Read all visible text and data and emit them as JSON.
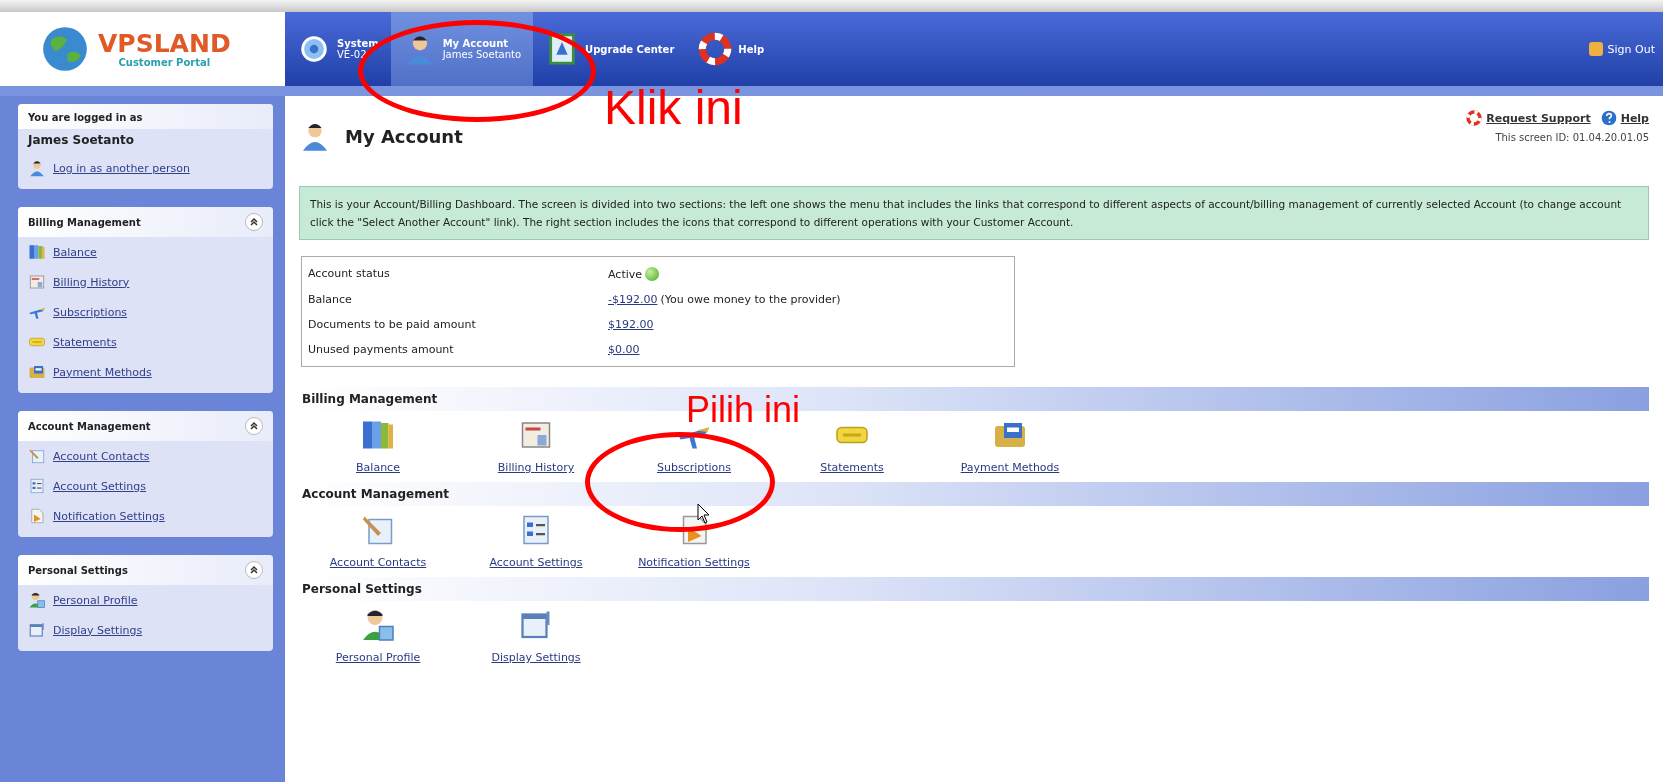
{
  "header": {
    "logo": {
      "name": "VPSLAND",
      "subtitle": "Customer Portal"
    },
    "tabs": [
      {
        "kind": "system",
        "title": "System",
        "subtitle": "VE-02",
        "selected": false
      },
      {
        "kind": "account",
        "title": "My Account",
        "subtitle": "James Soetanto",
        "selected": true
      },
      {
        "kind": "upgrade",
        "title": "Upgrade Center",
        "selected": false
      },
      {
        "kind": "help",
        "title": "Help",
        "selected": false
      }
    ],
    "sign_out": "Sign Out"
  },
  "sidebar": {
    "login": {
      "label": "You are logged in as",
      "user": "James Soetanto",
      "link": "Log in as another person"
    },
    "panels": [
      {
        "title": "Billing Management",
        "expanded": true,
        "items": [
          {
            "kind": "balance",
            "label": "Balance"
          },
          {
            "kind": "history",
            "label": "Billing History"
          },
          {
            "kind": "subscriptions",
            "label": "Subscriptions"
          },
          {
            "kind": "statements",
            "label": "Statements"
          },
          {
            "kind": "payment",
            "label": "Payment Methods"
          }
        ]
      },
      {
        "title": "Account Management",
        "expanded": true,
        "items": [
          {
            "kind": "contacts",
            "label": "Account Contacts"
          },
          {
            "kind": "settings",
            "label": "Account Settings"
          },
          {
            "kind": "notification",
            "label": "Notification Settings"
          }
        ]
      },
      {
        "title": "Personal Settings",
        "expanded": true,
        "items": [
          {
            "kind": "profile",
            "label": "Personal Profile"
          },
          {
            "kind": "display",
            "label": "Display Settings"
          }
        ]
      }
    ]
  },
  "page": {
    "title": "My Account",
    "request_support": "Request Support",
    "help": "Help",
    "screen_id": "This screen ID: 01.04.20.01.05",
    "info": "This is your Account/Billing Dashboard. The screen is divided into two sections: the left one shows the menu that includes the links that correspond to different aspects of account/billing management of currently selected Account (to change account click the \"Select Another Account\" link). The right section includes the icons that correspond to different operations with your Customer Account.",
    "summary": [
      {
        "label": "Account status",
        "value": "Active",
        "kind": "status"
      },
      {
        "label": "Balance",
        "value": "-$192.00",
        "note": "(You owe money to the provider)",
        "kind": "link"
      },
      {
        "label": "Documents to be paid amount",
        "value": "$192.00",
        "kind": "link"
      },
      {
        "label": "Unused payments amount",
        "value": "$0.00",
        "kind": "link"
      }
    ],
    "sections": [
      {
        "title": "Billing Management",
        "items": [
          {
            "kind": "balance",
            "label": "Balance"
          },
          {
            "kind": "history",
            "label": "Billing History"
          },
          {
            "kind": "subscriptions",
            "label": "Subscriptions"
          },
          {
            "kind": "statements",
            "label": "Statements"
          },
          {
            "kind": "payment",
            "label": "Payment Methods"
          }
        ]
      },
      {
        "title": "Account Management",
        "items": [
          {
            "kind": "contacts",
            "label": "Account Contacts"
          },
          {
            "kind": "settings",
            "label": "Account Settings"
          },
          {
            "kind": "notification",
            "label": "Notification Settings"
          }
        ]
      },
      {
        "title": "Personal Settings",
        "items": [
          {
            "kind": "profile",
            "label": "Personal Profile"
          },
          {
            "kind": "display",
            "label": "Display Settings"
          }
        ]
      }
    ]
  },
  "annotations": [
    {
      "text": "Klik ini"
    },
    {
      "text": "Pilih ini"
    }
  ]
}
